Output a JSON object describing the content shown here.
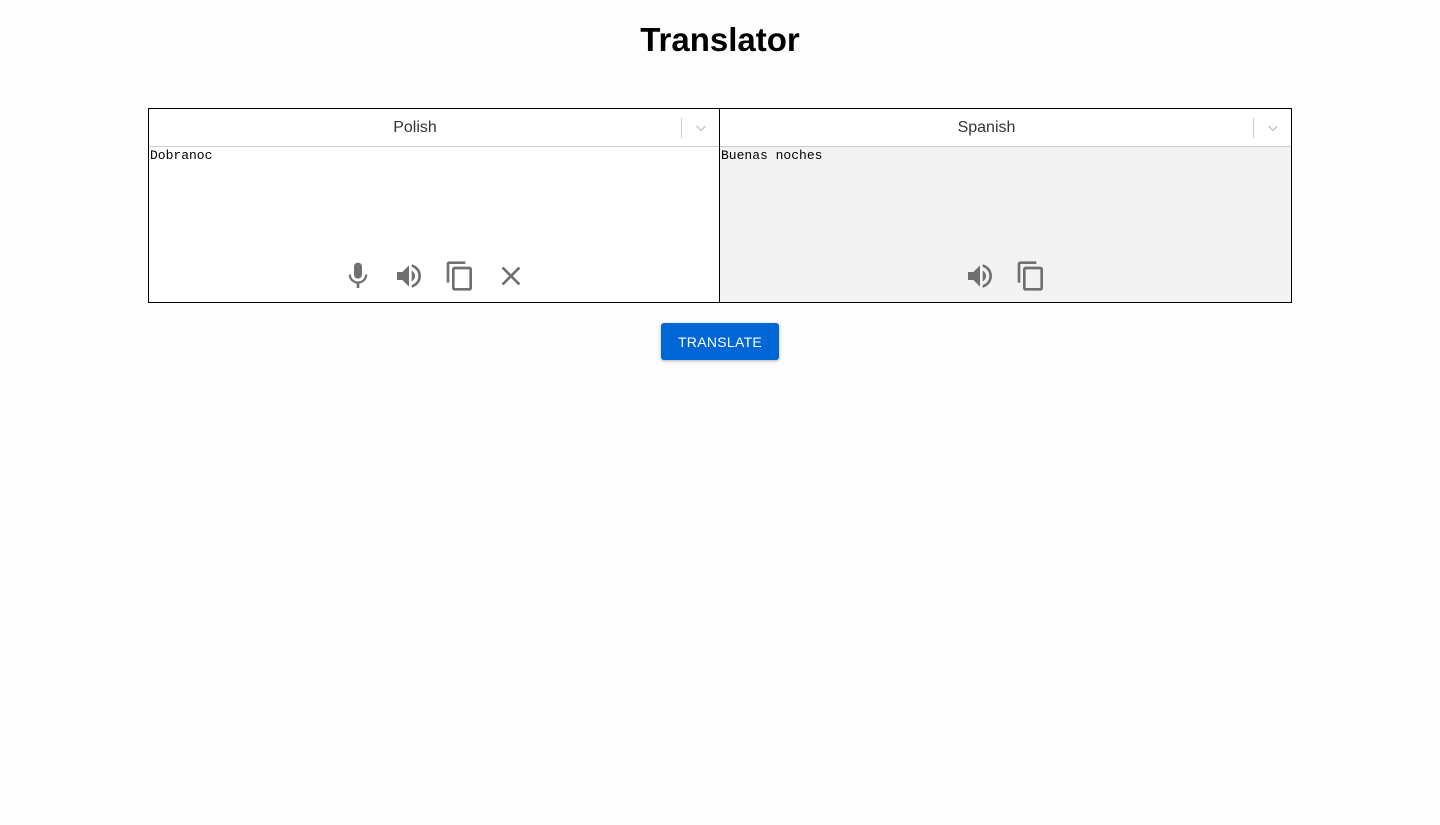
{
  "title": "Translator",
  "source": {
    "language": "Polish",
    "text": "Dobranoc",
    "icons": [
      "microphone-icon",
      "speaker-icon",
      "copy-icon",
      "close-icon"
    ]
  },
  "target": {
    "language": "Spanish",
    "text": "Buenas noches",
    "icons": [
      "speaker-icon",
      "copy-icon"
    ]
  },
  "translate_button": "TRANSLATE",
  "colors": {
    "accent": "#0066d6",
    "icon": "#707070",
    "target_background": "#f3f3f3"
  }
}
